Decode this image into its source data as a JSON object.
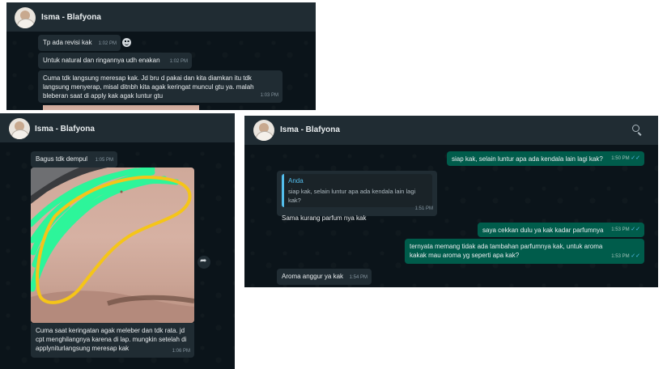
{
  "contact_name": "Isma - Blafyona",
  "panel_top": {
    "messages": [
      {
        "text": "Tp ada revisi kak",
        "time": "1:02 PM"
      },
      {
        "text": "Untuk natural dan ringannya udh enakan",
        "time": "1:02 PM"
      },
      {
        "text": "Cuma tdk langsung meresap kak. Jd bru d pakai dan kita diamkan itu tdk langsung menyerap, misal ditnbh kita agak keringat muncul gtu ya. malah bleberan saat di apply kak agak luntur gtu",
        "time": "1:03 PM"
      }
    ]
  },
  "panel_left": {
    "messages": [
      {
        "text": "Bagus tdk dempul",
        "time": "1:05 PM"
      },
      {
        "text": "Cuma saat keringatan agak meleber dan tdk rata. jd cpt menghilangnya karena di lap. mungkin setelah di applyniturlangsung meresap kak",
        "time": "1:06 PM"
      }
    ]
  },
  "panel_right": {
    "messages": [
      {
        "text": "siap kak, selain luntur apa ada kendala lain lagi kak?",
        "time": "1:50 PM",
        "outgoing": true
      },
      {
        "quote_author": "Anda",
        "quote_text": "siap kak, selain luntur apa ada kendala lain lagi kak?",
        "text": "Sama kurang parfum nya kak",
        "time": "1:51 PM"
      },
      {
        "text": "saya cekkan dulu ya kak kadar parfumnya",
        "time": "1:53 PM",
        "outgoing": true
      },
      {
        "text": "ternyata memang tidak ada tambahan parfumnya kak, untuk aroma kakak mau aroma yg seperti apa kak?",
        "time": "1:53 PM",
        "outgoing": true
      },
      {
        "text": "Aroma anggur ya kak",
        "time": "1:54 PM"
      }
    ]
  },
  "icons": [
    "avatar",
    "emoji-icon",
    "forward-icon",
    "search-icon",
    "double-check-icon"
  ],
  "colors": {
    "bg": "#0b141a",
    "header": "#202c33",
    "incoming": "#202c33",
    "outgoing": "#005c4b",
    "ticks": "#53bdeb",
    "highlight_green": "#2df59a",
    "outline_yellow": "#f5c518"
  }
}
